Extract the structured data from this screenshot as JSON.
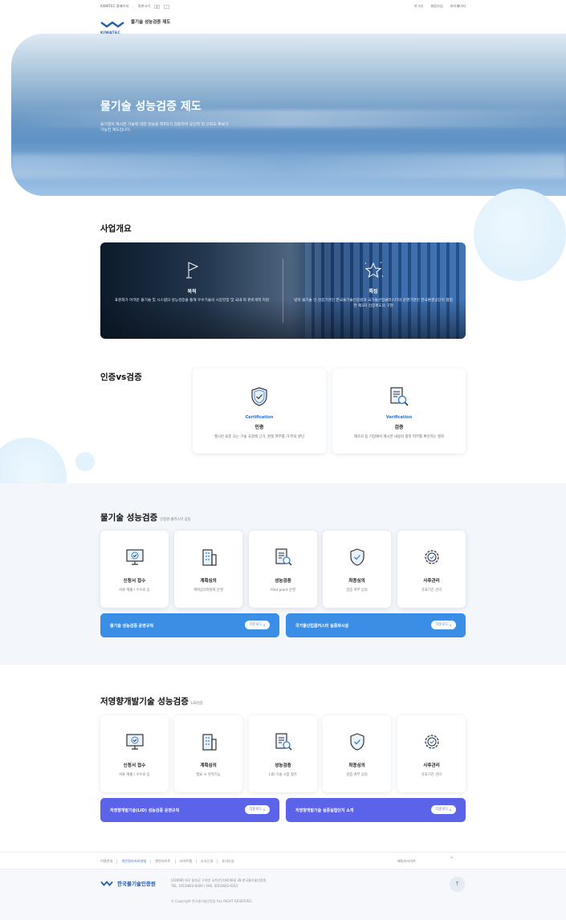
{
  "topbar": {
    "site": "KIWATEC 홈페이지",
    "font_size_label": "화면크기",
    "plus": "+",
    "minus": "-",
    "links": [
      "로그인",
      "회원가입",
      "마이페이지"
    ]
  },
  "logo": {
    "brand": "KIWATEC",
    "title": "물기술 성능검증 제도"
  },
  "hero": {
    "title": "물기술 성능검증 제도",
    "desc": "물기업이 제시한 기술에 대한 성능을 제3자가 검증하여 공신력 및 신뢰도 확보가 가능한 제도입니다."
  },
  "overview": {
    "title": "사업개요",
    "purpose": {
      "title": "목적",
      "desc": "표준화가 어려운 물기술 및 시스템의 성능검증을 통해 우수기술의 시장진입 및 국내·외 판로개척 지원"
    },
    "feature": {
      "title": "특징",
      "desc": "법적 물기술 인·검증기관인 한국물기술인증원과 국가물산업클러스터의 운영기관인 한국환경공단이 협업한 제3자 검증제도의 구현"
    }
  },
  "cert_vs": {
    "title": "인증vs검증",
    "cert": {
      "en": "Certification",
      "ko": "인증",
      "desc": "행시된 표준 또는 기술 규정에 근거, 판정 여부를 가·부로 판단"
    },
    "verif": {
      "en": "Verification",
      "ko": "검증",
      "desc": "제조자 등 기업에서 제시한 내용이 충족 여부를 확인하는 절차"
    }
  },
  "perf": {
    "title": "물기술 성능검증",
    "sub": "인증원·클러스터 공동",
    "steps": [
      {
        "t": "신청서 접수",
        "d": "서류 제출 / 수수료 등"
      },
      {
        "t": "계획심의",
        "d": "계획심의위원회 운영"
      },
      {
        "t": "성능검증",
        "d": "Pilot plant 운영"
      },
      {
        "t": "최종심의",
        "d": "검증 여부 심의"
      },
      {
        "t": "사후관리",
        "d": "유효기간 관리"
      }
    ],
    "dl1": "물기술 성능검증 운영규칙",
    "dl2": "국가물산업클러스터 실증화시설",
    "btn": "다운로드 ⤓"
  },
  "lid": {
    "title": "저영향개발기술 성능검증",
    "sub": "LID검증",
    "steps": [
      {
        "t": "신청서 접수",
        "d": "서류 제출 / 수수료 등"
      },
      {
        "t": "계획심의",
        "d": "필요 시 현작기능"
      },
      {
        "t": "성능검증",
        "d": "LID 기술 시험 평가"
      },
      {
        "t": "최종심의",
        "d": "검증 여부 심의"
      },
      {
        "t": "사후관리",
        "d": "유효기간 관리"
      }
    ],
    "dl1": "저영향개발기술(LID) 성능검증 운영규칙",
    "dl2": "저영향개발기술 실증실험단지 소개",
    "btn": "다운로드 ⤓"
  },
  "footer": {
    "links": [
      "이용안내",
      "개인정보처리방침",
      "관련사이트",
      "사이트맵",
      "오시는길",
      "유사논길"
    ],
    "family": "패밀리사이트",
    "org": "한국물기술인증원",
    "addr": "[43008] 대구 달성군 구지면 국가산단대로40길 28 한국물기술인증원",
    "tel": "TEL. (053)602-6300  /  FAX. (053)602-6315",
    "copy": "© Copyright 한국물기술인증원 ALL RIGHT RESERVED",
    "up": "↑",
    "fam_arrow": "^"
  }
}
